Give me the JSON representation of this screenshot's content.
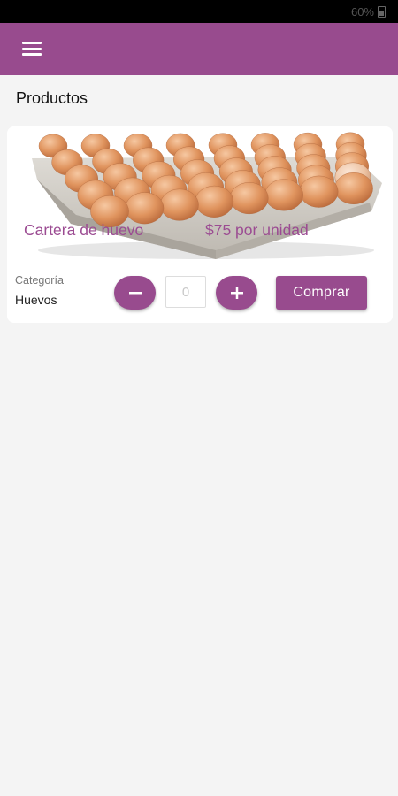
{
  "status_bar": {
    "battery": "60%"
  },
  "colors": {
    "primary": "#984b8e",
    "accent_text": "#9b4b92",
    "background": "#f4f4f4"
  },
  "app_bar": {
    "menu_icon": "hamburger-menu-icon"
  },
  "page": {
    "title": "Productos"
  },
  "products": [
    {
      "name": "Cartera de huevo",
      "price": "$75 por unidad",
      "image": "egg-carton-image",
      "category_label": "Categoría",
      "category_value": "Huevos",
      "quantity_placeholder": "0",
      "buy_label": "Comprar"
    }
  ]
}
